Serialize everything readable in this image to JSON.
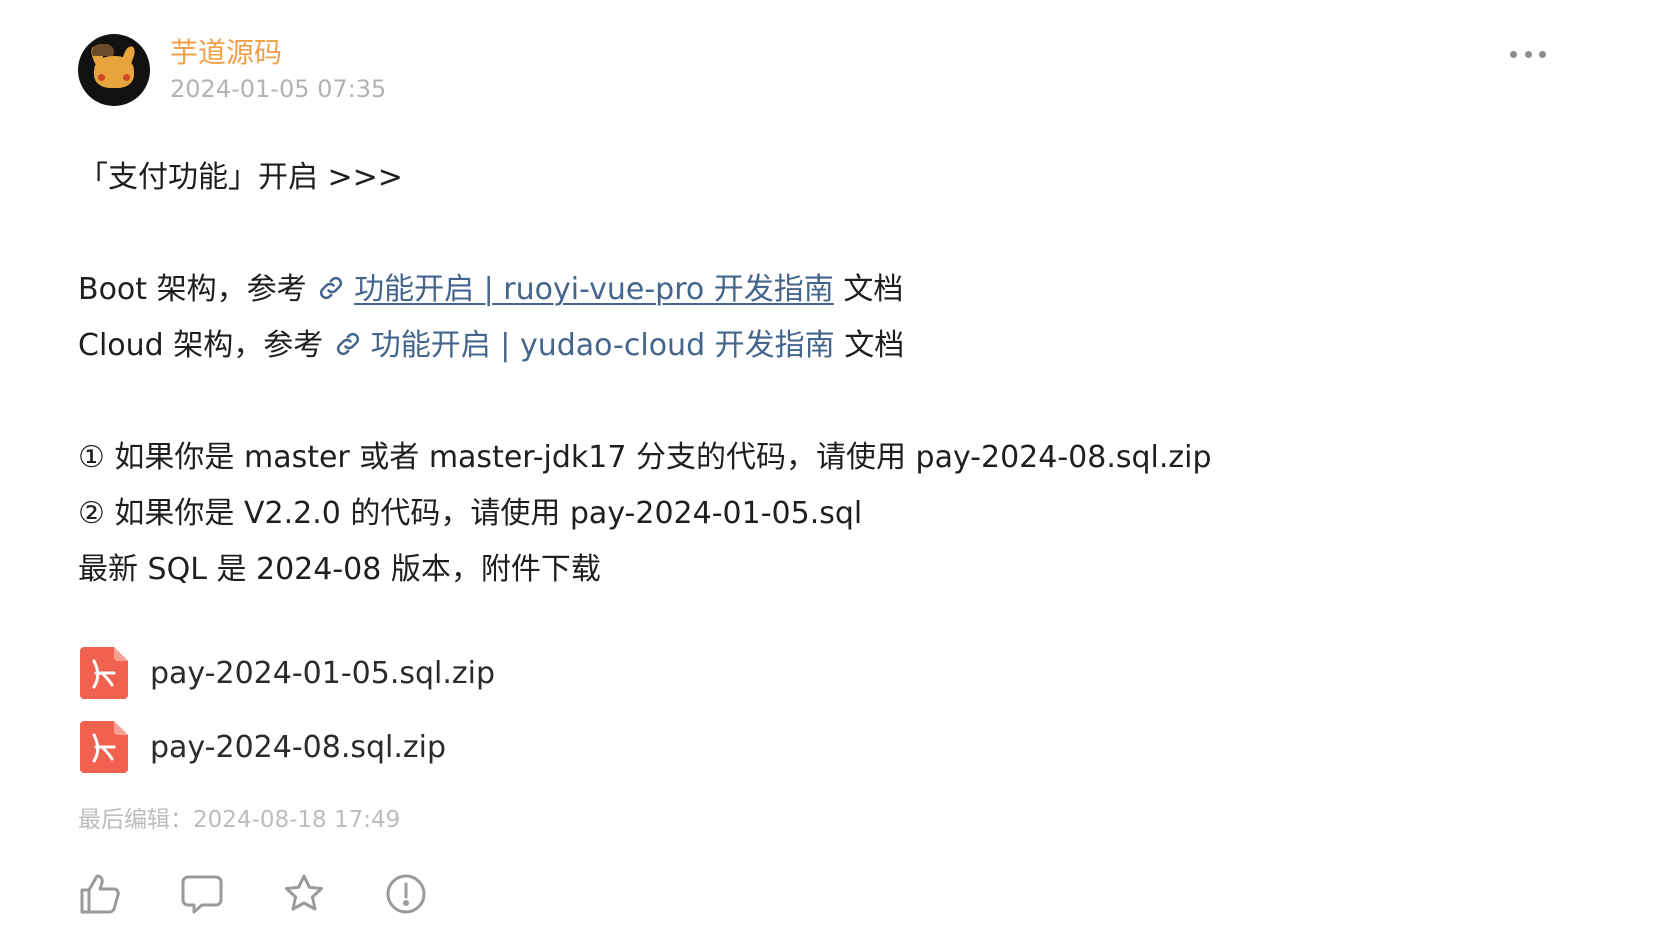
{
  "post": {
    "author": "芋道源码",
    "time": "2024-01-05 07:35",
    "more_icon": "more-icon",
    "heading": "「支付功能」开启 >>>",
    "boot": {
      "prefix": "Boot 架构，参考 ",
      "link": "功能开启 | ruoyi-vue-pro 开发指南",
      "suffix": " 文档"
    },
    "cloud": {
      "prefix": "Cloud 架构，参考 ",
      "link": "功能开启 | yudao-cloud 开发指南",
      "suffix": " 文档"
    },
    "note1": "① 如果你是 master 或者 master-jdk17 分支的代码，请使用 pay-2024-08.sql.zip",
    "note2": "② 如果你是 V2.2.0 的代码，请使用 pay-2024-01-05.sql",
    "note3": "最新 SQL 是 2024-08 版本，附件下载",
    "attachments": [
      {
        "name": "pay-2024-01-05.sql.zip",
        "icon": "pdf-icon"
      },
      {
        "name": "pay-2024-08.sql.zip",
        "icon": "pdf-icon"
      }
    ],
    "edited": "最后编辑：2024-08-18 17:49"
  },
  "actions": [
    {
      "icon": "like-icon"
    },
    {
      "icon": "comment-icon"
    },
    {
      "icon": "star-icon"
    },
    {
      "icon": "report-icon"
    }
  ],
  "colors": {
    "author": "#f0a04b",
    "link": "#44658c",
    "muted": "#b3b3b3",
    "pdf": "#f0614f"
  }
}
